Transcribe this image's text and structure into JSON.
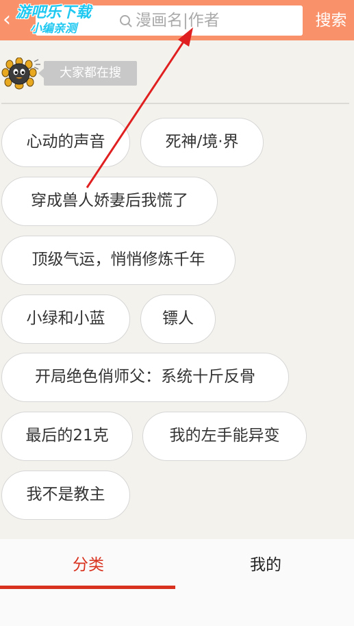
{
  "header": {
    "back_icon": "chevron-left-icon",
    "search_placeholder": "漫画名|作者",
    "search_button_label": "搜索",
    "watermark_line1": "游吧乐下载",
    "watermark_line2": "小编亲测"
  },
  "hot_search": {
    "label": "大家都在搜",
    "tags": [
      "心动的声音",
      "死神/境·界",
      "穿成兽人娇妻后我慌了",
      "顶级气运，悄悄修炼千年",
      "小绿和小蓝",
      "镖人",
      "开局绝色俏师父：系统十斤反骨",
      "最后的21克",
      "我的左手能异变",
      "我不是教主"
    ]
  },
  "tabs": {
    "category_label": "分类",
    "mine_label": "我的",
    "active": "分类"
  },
  "colors": {
    "header_bg": "#f9916a",
    "accent_red": "#d8321f",
    "page_bg": "#f4f2ec"
  }
}
